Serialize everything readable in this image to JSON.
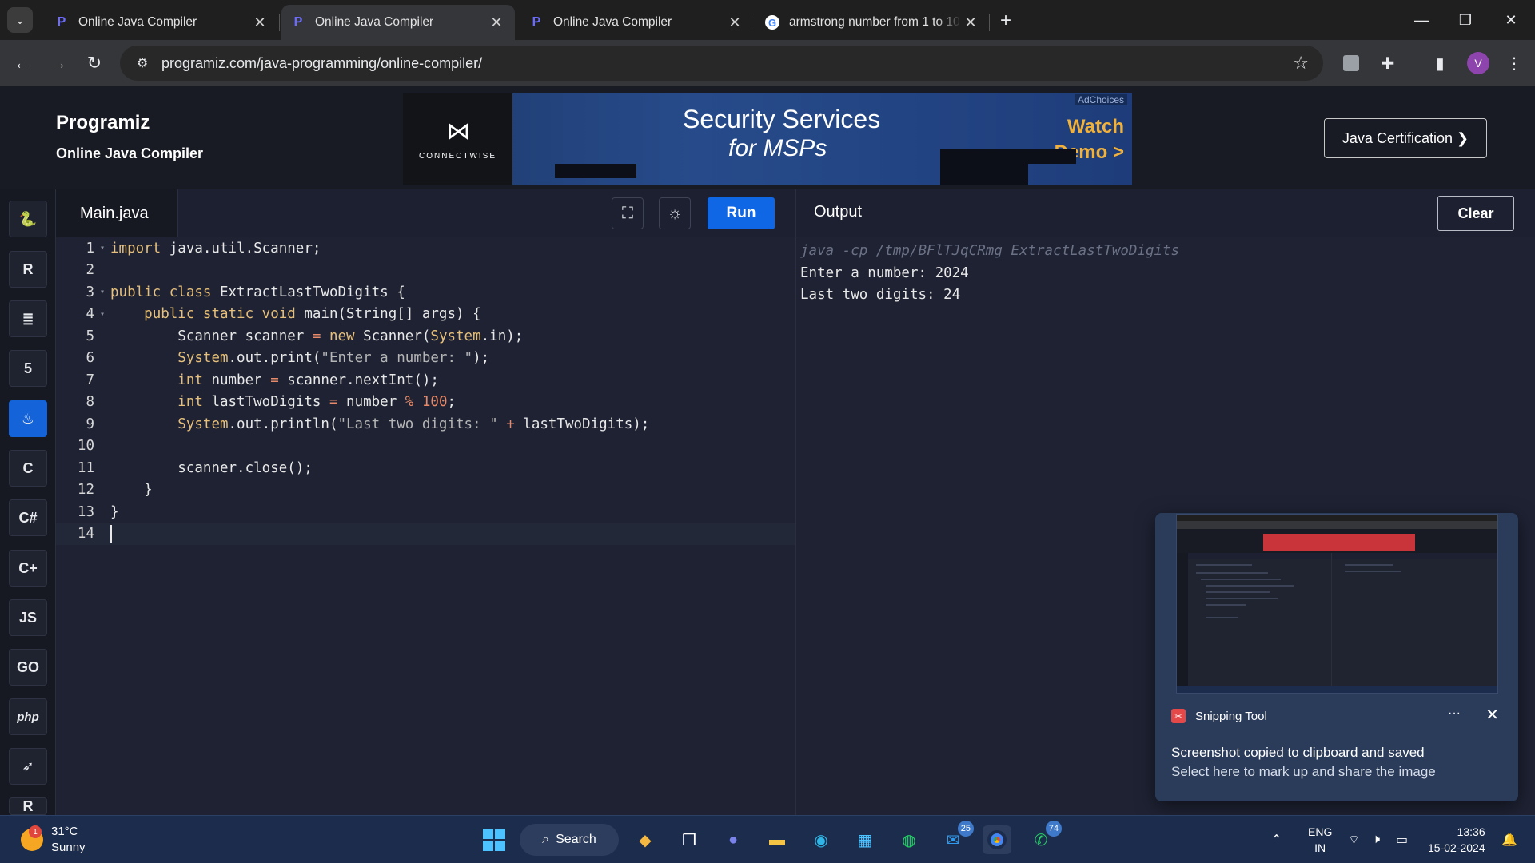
{
  "browser": {
    "tabs": [
      {
        "title": "Online Java Compiler",
        "active": false,
        "icon": "programiz-favicon"
      },
      {
        "title": "Online Java Compiler",
        "active": true,
        "icon": "programiz-favicon"
      },
      {
        "title": "Online Java Compiler",
        "active": false,
        "icon": "programiz-favicon"
      },
      {
        "title": "armstrong number from 1 to 10",
        "active": false,
        "icon": "google-favicon"
      }
    ],
    "url": "programiz.com/java-programming/online-compiler/",
    "profile_initial": "V"
  },
  "site": {
    "logo": "Programiz",
    "subtitle": "Online Java Compiler",
    "certification_button": "Java Certification ❯"
  },
  "ad": {
    "brand": "CONNECTWISE",
    "headline": "Security Services",
    "subheadline": "for MSPs",
    "cta": "Watch Demo >",
    "adchoices": "AdChoices"
  },
  "languages": [
    {
      "name": "python",
      "label": "🐍"
    },
    {
      "name": "r",
      "label": "R"
    },
    {
      "name": "sql",
      "label": "≣"
    },
    {
      "name": "html",
      "label": "5"
    },
    {
      "name": "java",
      "label": "♨",
      "active": true
    },
    {
      "name": "c",
      "label": "C"
    },
    {
      "name": "csharp",
      "label": "C#"
    },
    {
      "name": "cpp",
      "label": "C+"
    },
    {
      "name": "javascript",
      "label": "JS"
    },
    {
      "name": "go",
      "label": "GO"
    },
    {
      "name": "php",
      "label": "php"
    },
    {
      "name": "swift",
      "label": "➶"
    },
    {
      "name": "rust",
      "label": "R"
    }
  ],
  "editor": {
    "file_tab": "Main.java",
    "run_label": "Run",
    "lines": [
      {
        "n": "1",
        "fold": true,
        "html": "<span class=\"kw\">import</span> java.util.Scanner;"
      },
      {
        "n": "2",
        "fold": false,
        "html": ""
      },
      {
        "n": "3",
        "fold": true,
        "html": "<span class=\"kw\">public class</span> ExtractLastTwoDigits {"
      },
      {
        "n": "4",
        "fold": true,
        "html": "    <span class=\"kw\">public static void</span> main(String[] args) {"
      },
      {
        "n": "5",
        "fold": false,
        "html": "        Scanner scanner <span class=\"op\">=</span> <span class=\"kw\">new</span> Scanner(<span class=\"ty\">System</span>.in);"
      },
      {
        "n": "6",
        "fold": false,
        "html": "        <span class=\"ty\">System</span>.out.print(<span class=\"str\">\"Enter a number: \"</span>);"
      },
      {
        "n": "7",
        "fold": false,
        "html": "        <span class=\"kw\">int</span> number <span class=\"op\">=</span> scanner.nextInt();"
      },
      {
        "n": "8",
        "fold": false,
        "html": "        <span class=\"kw\">int</span> lastTwoDigits <span class=\"op\">=</span> number <span class=\"op\">%</span> <span class=\"op\">100</span>;"
      },
      {
        "n": "9",
        "fold": false,
        "html": "        <span class=\"ty\">System</span>.out.println(<span class=\"str\">\"Last two digits: \"</span> <span class=\"op\">+</span> lastTwoDigits);"
      },
      {
        "n": "10",
        "fold": false,
        "html": ""
      },
      {
        "n": "11",
        "fold": false,
        "html": "        scanner.close();"
      },
      {
        "n": "12",
        "fold": false,
        "html": "    }"
      },
      {
        "n": "13",
        "fold": false,
        "html": "}"
      },
      {
        "n": "14",
        "fold": false,
        "html": "",
        "current": true
      }
    ]
  },
  "output": {
    "title": "Output",
    "clear_label": "Clear",
    "command": "java -cp /tmp/BFlTJqCRmg ExtractLastTwoDigits",
    "lines": [
      "Enter a number: 2024",
      "Last two digits: 24"
    ]
  },
  "notification": {
    "app": "Snipping Tool",
    "line1": "Screenshot copied to clipboard and saved",
    "line2": "Select here to mark up and share the image"
  },
  "taskbar": {
    "temperature": "31°C",
    "condition": "Sunny",
    "weather_badge": "1",
    "search_label": "Search",
    "outlook_badge": "25",
    "whatsapp_badge": "74",
    "language": "ENG",
    "region": "IN",
    "time": "13:36",
    "date": "15-02-2024"
  }
}
